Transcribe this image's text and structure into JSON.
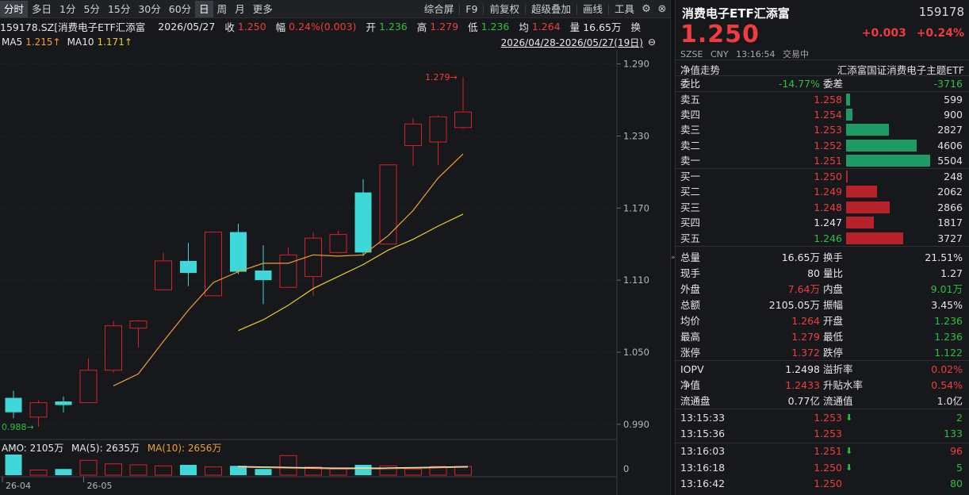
{
  "toolbar": {
    "tabs": [
      "分时",
      "多日",
      "1分",
      "5分",
      "15分",
      "30分",
      "60分",
      "日",
      "周",
      "月",
      "更多"
    ],
    "active_index": 7,
    "right_items": [
      "综合屏",
      "F9",
      "前复权",
      "超级叠加",
      "画线",
      "工具"
    ]
  },
  "info": {
    "code_name": "159178.SZ[消费电子ETF汇添富",
    "date": "2026/05/27",
    "close_label": "收",
    "close": "1.250",
    "change_label": "幅",
    "change": "0.24%(0.003)",
    "open_label": "开",
    "open": "1.236",
    "high_label": "高",
    "high": "1.279",
    "low_label": "低",
    "low": "1.236",
    "avg_label": "均",
    "avg": "1.264",
    "vol_label": "量",
    "vol": "16.65万",
    "turn_label": "换"
  },
  "ma": {
    "ma5_label": "MA5",
    "ma5": "1.215↑",
    "ma10_label": "MA10",
    "ma10": "1.171↑",
    "range": "2026/04/28-2026/05/27(19日)"
  },
  "volume": {
    "amo_label": "AMO: 2105万",
    "ma5_label": "MA(5): 2635万",
    "ma10_label": "MA(10): 2656万",
    "axis_zero": "0"
  },
  "chart_data": {
    "type": "candlestick",
    "y_ticks": [
      "1.290",
      "1.230",
      "1.170",
      "1.110",
      "1.050",
      "0.990"
    ],
    "y_tick_values": [
      1.29,
      1.23,
      1.17,
      1.11,
      1.05,
      0.99
    ],
    "ylim": [
      0.98,
      1.295
    ],
    "x_labels": [
      "26-04",
      "26-05"
    ],
    "annotations": {
      "max": "1.279",
      "min": "0.988"
    },
    "candles": [
      {
        "o": 1.012,
        "h": 1.018,
        "l": 0.995,
        "c": 1.0,
        "dir": "down"
      },
      {
        "o": 0.996,
        "h": 1.01,
        "l": 0.988,
        "c": 1.008,
        "dir": "up"
      },
      {
        "o": 1.009,
        "h": 1.013,
        "l": 1.0,
        "c": 1.006,
        "dir": "down"
      },
      {
        "o": 1.008,
        "h": 1.045,
        "l": 1.008,
        "c": 1.035,
        "dir": "up"
      },
      {
        "o": 1.035,
        "h": 1.076,
        "l": 1.033,
        "c": 1.072,
        "dir": "up"
      },
      {
        "o": 1.07,
        "h": 1.077,
        "l": 1.054,
        "c": 1.076,
        "dir": "up"
      },
      {
        "o": 1.102,
        "h": 1.133,
        "l": 1.102,
        "c": 1.126,
        "dir": "up"
      },
      {
        "o": 1.126,
        "h": 1.141,
        "l": 1.105,
        "c": 1.116,
        "dir": "down"
      },
      {
        "o": 1.097,
        "h": 1.15,
        "l": 1.097,
        "c": 1.15,
        "dir": "up"
      },
      {
        "o": 1.15,
        "h": 1.157,
        "l": 1.115,
        "c": 1.117,
        "dir": "down"
      },
      {
        "o": 1.118,
        "h": 1.139,
        "l": 1.09,
        "c": 1.11,
        "dir": "down"
      },
      {
        "o": 1.104,
        "h": 1.137,
        "l": 1.104,
        "c": 1.131,
        "dir": "up"
      },
      {
        "o": 1.113,
        "h": 1.15,
        "l": 1.097,
        "c": 1.145,
        "dir": "up"
      },
      {
        "o": 1.133,
        "h": 1.151,
        "l": 1.133,
        "c": 1.148,
        "dir": "up"
      },
      {
        "o": 1.183,
        "h": 1.194,
        "l": 1.13,
        "c": 1.133,
        "dir": "down"
      },
      {
        "o": 1.14,
        "h": 1.206,
        "l": 1.14,
        "c": 1.206,
        "dir": "up"
      },
      {
        "o": 1.222,
        "h": 1.245,
        "l": 1.205,
        "c": 1.24,
        "dir": "up"
      },
      {
        "o": 1.225,
        "h": 1.247,
        "l": 1.206,
        "c": 1.246,
        "dir": "up"
      },
      {
        "o": 1.237,
        "h": 1.279,
        "l": 1.236,
        "c": 1.25,
        "dir": "up"
      }
    ],
    "ma5_series": [
      null,
      null,
      null,
      null,
      1.022,
      1.032,
      1.059,
      1.085,
      1.108,
      1.117,
      1.124,
      1.124,
      1.131,
      1.13,
      1.131,
      1.147,
      1.168,
      1.195,
      1.215
    ],
    "ma10_series": [
      null,
      null,
      null,
      null,
      null,
      null,
      null,
      null,
      null,
      1.068,
      1.077,
      1.089,
      1.103,
      1.113,
      1.123,
      1.135,
      1.144,
      1.155,
      1.165
    ],
    "volumes": [
      1.0,
      0.25,
      0.3,
      0.72,
      0.55,
      0.5,
      0.45,
      0.5,
      0.4,
      0.45,
      0.3,
      0.95,
      0.4,
      0.3,
      0.5,
      0.45,
      0.3,
      0.42,
      0.42,
      0.35
    ]
  },
  "panel": {
    "title": "消费电子ETF汇添富",
    "code": "159178",
    "price": "1.250",
    "change": "+0.003",
    "change_pct": "+0.24%",
    "market": "SZSE",
    "currency": "CNY",
    "time": "13:16:54",
    "status": "交易中",
    "nav_trend": "净值走势",
    "index_name": "汇添富国证消费电子主题ETF",
    "weibi_label": "委比",
    "weibi": "-14.77%",
    "weicha_label": "委差",
    "weicha": "-3716",
    "asks": [
      {
        "label": "卖五",
        "price": "1.258",
        "vol": "599",
        "bar": 0.05
      },
      {
        "label": "卖四",
        "price": "1.254",
        "vol": "900",
        "bar": 0.08
      },
      {
        "label": "卖三",
        "price": "1.253",
        "vol": "2827",
        "bar": 0.51
      },
      {
        "label": "卖二",
        "price": "1.252",
        "vol": "4606",
        "bar": 0.84
      },
      {
        "label": "卖一",
        "price": "1.251",
        "vol": "5504",
        "bar": 1.0
      }
    ],
    "bids": [
      {
        "label": "买一",
        "price": "1.250",
        "vol": "248",
        "bar": 0.02,
        "dir": "up"
      },
      {
        "label": "买二",
        "price": "1.249",
        "vol": "2062",
        "bar": 0.37,
        "dir": "up"
      },
      {
        "label": "买三",
        "price": "1.248",
        "vol": "2866",
        "bar": 0.52,
        "dir": "up"
      },
      {
        "label": "买四",
        "price": "1.247",
        "vol": "1817",
        "bar": 0.33,
        "dir": "flat"
      },
      {
        "label": "买五",
        "price": "1.246",
        "vol": "3727",
        "bar": 0.68,
        "dir": "down"
      }
    ],
    "stats": [
      {
        "l1": "总量",
        "v1": "16.65万",
        "c1": "white",
        "l2": "换手",
        "v2": "21.51%",
        "c2": "white"
      },
      {
        "l1": "现手",
        "v1": "80",
        "c1": "white",
        "l2": "量比",
        "v2": "1.27",
        "c2": "white"
      },
      {
        "l1": "外盘",
        "v1": "7.64万",
        "c1": "up",
        "l2": "内盘",
        "v2": "9.01万",
        "c2": "down"
      },
      {
        "l1": "总额",
        "v1": "2105.05万",
        "c1": "white",
        "l2": "振幅",
        "v2": "3.45%",
        "c2": "white"
      },
      {
        "l1": "均价",
        "v1": "1.264",
        "c1": "up",
        "l2": "开盘",
        "v2": "1.236",
        "c2": "down"
      },
      {
        "l1": "最高",
        "v1": "1.279",
        "c1": "up",
        "l2": "最低",
        "v2": "1.236",
        "c2": "down"
      },
      {
        "l1": "涨停",
        "v1": "1.372",
        "c1": "up",
        "l2": "跌停",
        "v2": "1.122",
        "c2": "down"
      }
    ],
    "stats2": [
      {
        "l1": "IOPV",
        "v1": "1.2498",
        "c1": "white",
        "l2": "溢折率",
        "v2": "0.02%",
        "c2": "up"
      },
      {
        "l1": "净值",
        "v1": "1.2433",
        "c1": "up",
        "l2": "升贴水率",
        "v2": "0.54%",
        "c2": "up"
      },
      {
        "l1": "流通盘",
        "v1": "0.77亿",
        "c1": "white",
        "l2": "流通值",
        "v2": "1.0亿",
        "c2": "white"
      }
    ],
    "ticks": [
      {
        "time": "13:15:33",
        "price": "1.253",
        "arrow": "⬇",
        "vol": "2",
        "vdir": "down"
      },
      {
        "time": "13:15:36",
        "price": "1.253",
        "arrow": "",
        "vol": "133",
        "vdir": "down"
      },
      {
        "time": "13:16:03",
        "price": "1.251",
        "arrow": "⬇",
        "vol": "96",
        "vdir": "up"
      },
      {
        "time": "13:16:18",
        "price": "1.250",
        "arrow": "⬇",
        "vol": "5",
        "vdir": "down"
      },
      {
        "time": "13:16:42",
        "price": "1.250",
        "arrow": "",
        "vol": "80",
        "vdir": "down"
      }
    ]
  },
  "colors": {
    "up": "#f03c3c",
    "down": "#27c23e",
    "cyan": "#3fd8d8",
    "ma5": "#f0a030",
    "ma10": "#e8d020",
    "ask_bar": "#1e9a64",
    "bid_bar": "#b8202a"
  }
}
